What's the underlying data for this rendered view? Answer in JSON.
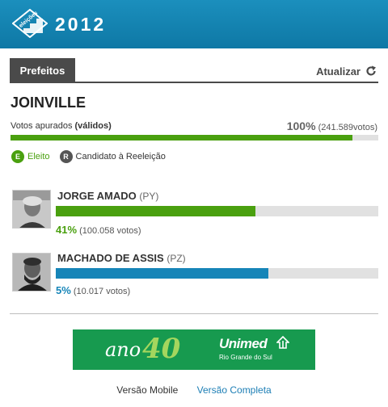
{
  "header": {
    "logo_text": "eleições",
    "year": "2012",
    "brand_color": "#1487b6"
  },
  "tabs": {
    "active_label": "Prefeitos",
    "refresh_label": "Atualizar",
    "refresh_icon": "refresh-icon"
  },
  "city": "JOINVILLE",
  "turnout": {
    "label_prefix": "Votos apurados",
    "label_bold": "(válidos)",
    "percent": "100%",
    "votes": "(241.589votos)",
    "fill": 0.93,
    "color": "#4aa00f"
  },
  "legend": [
    {
      "symbol": "E",
      "label": "Eleito",
      "color": "#4aa00f"
    },
    {
      "symbol": "R",
      "label": "Candidato à Reeleição",
      "color": "#555555"
    }
  ],
  "candidates": [
    {
      "name": "JORGE AMADO",
      "party": "(PY)",
      "percent": "41%",
      "votes": "(100.058 votos)",
      "fill": 0.62,
      "color": "#4aa00f",
      "photo_icon": "candidate-photo"
    },
    {
      "name": "MACHADO DE ASSIS",
      "party": "(PZ)",
      "percent": "5%",
      "votes": "(10.017 votos)",
      "fill": 0.66,
      "color": "#1685b8",
      "photo_icon": "candidate-photo"
    }
  ],
  "banner": {
    "ano": "ano",
    "number": "40",
    "brand": "Unimed",
    "sub": "Rio Grande do Sul",
    "bg_color": "#179a4f"
  },
  "footer": {
    "mobile": "Versão Mobile",
    "full": "Versão Completa"
  }
}
